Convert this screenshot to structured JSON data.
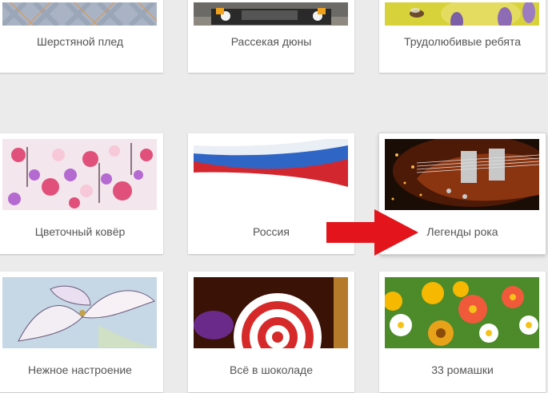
{
  "cards": [
    {
      "label": "Шерстяной плед",
      "image": "wool-plaid-pattern"
    },
    {
      "label": "Рассекая дюны",
      "image": "offroad-vehicle"
    },
    {
      "label": "Трудолюбивые ребята",
      "image": "bee-lavender"
    },
    {
      "label": "Цветочный ковёр",
      "image": "floral-pattern"
    },
    {
      "label": "Россия",
      "image": "russian-flag-ribbon"
    },
    {
      "label": "Легенды рока",
      "image": "electric-guitar"
    },
    {
      "label": "Нежное настроение",
      "image": "lily-sketch"
    },
    {
      "label": "Всё в шоколаде",
      "image": "lollipop-candy"
    },
    {
      "label": "33 ромашки",
      "image": "daisies-flowers"
    }
  ],
  "pointer": {
    "icon": "red-arrow-icon",
    "color": "#e3141b",
    "target": "Легенды рока"
  }
}
